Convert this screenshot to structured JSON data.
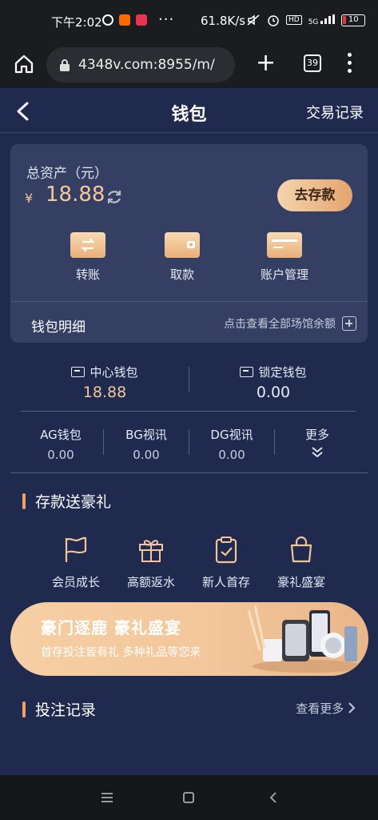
{
  "status_bar": {
    "time": "下午2:02",
    "speed": "61.8K/s",
    "network": "5G",
    "hd": "HD",
    "battery": "10",
    "more": "···"
  },
  "browser": {
    "url": "4348v.com:8955/m/",
    "tab_count": "39"
  },
  "header": {
    "title": "钱包",
    "records": "交易记录"
  },
  "assets": {
    "label": "总资产（元）",
    "currency": "¥",
    "amount": "18.88",
    "deposit_button": "去存款"
  },
  "quick_actions": [
    {
      "label": "转账"
    },
    {
      "label": "取款"
    },
    {
      "label": "账户管理"
    }
  ],
  "detail": {
    "title": "钱包明细",
    "view_all": "点击查看全部场馆余额"
  },
  "wallets": [
    {
      "label": "中心钱包",
      "value": "18.88"
    },
    {
      "label": "锁定钱包",
      "value": "0.00"
    }
  ],
  "sub_wallets": [
    {
      "label": "AG钱包",
      "value": "0.00"
    },
    {
      "label": "BG视讯",
      "value": "0.00"
    },
    {
      "label": "DG视讯",
      "value": "0.00"
    }
  ],
  "more_label": "更多",
  "promo_section": {
    "title": "存款送豪礼"
  },
  "promos": [
    {
      "label": "会员成长"
    },
    {
      "label": "高额返水"
    },
    {
      "label": "新人首存"
    },
    {
      "label": "豪礼盛宴"
    }
  ],
  "banner": {
    "title": "豪门逐鹿 豪礼盛宴",
    "subtitle": "首存投注皆有礼 多种礼品等您来"
  },
  "records_section": {
    "title": "投注记录",
    "see_more": "查看更多"
  },
  "colors": {
    "background": "#1f2a4e",
    "card": "#343f63",
    "accent": "#f0c598"
  }
}
